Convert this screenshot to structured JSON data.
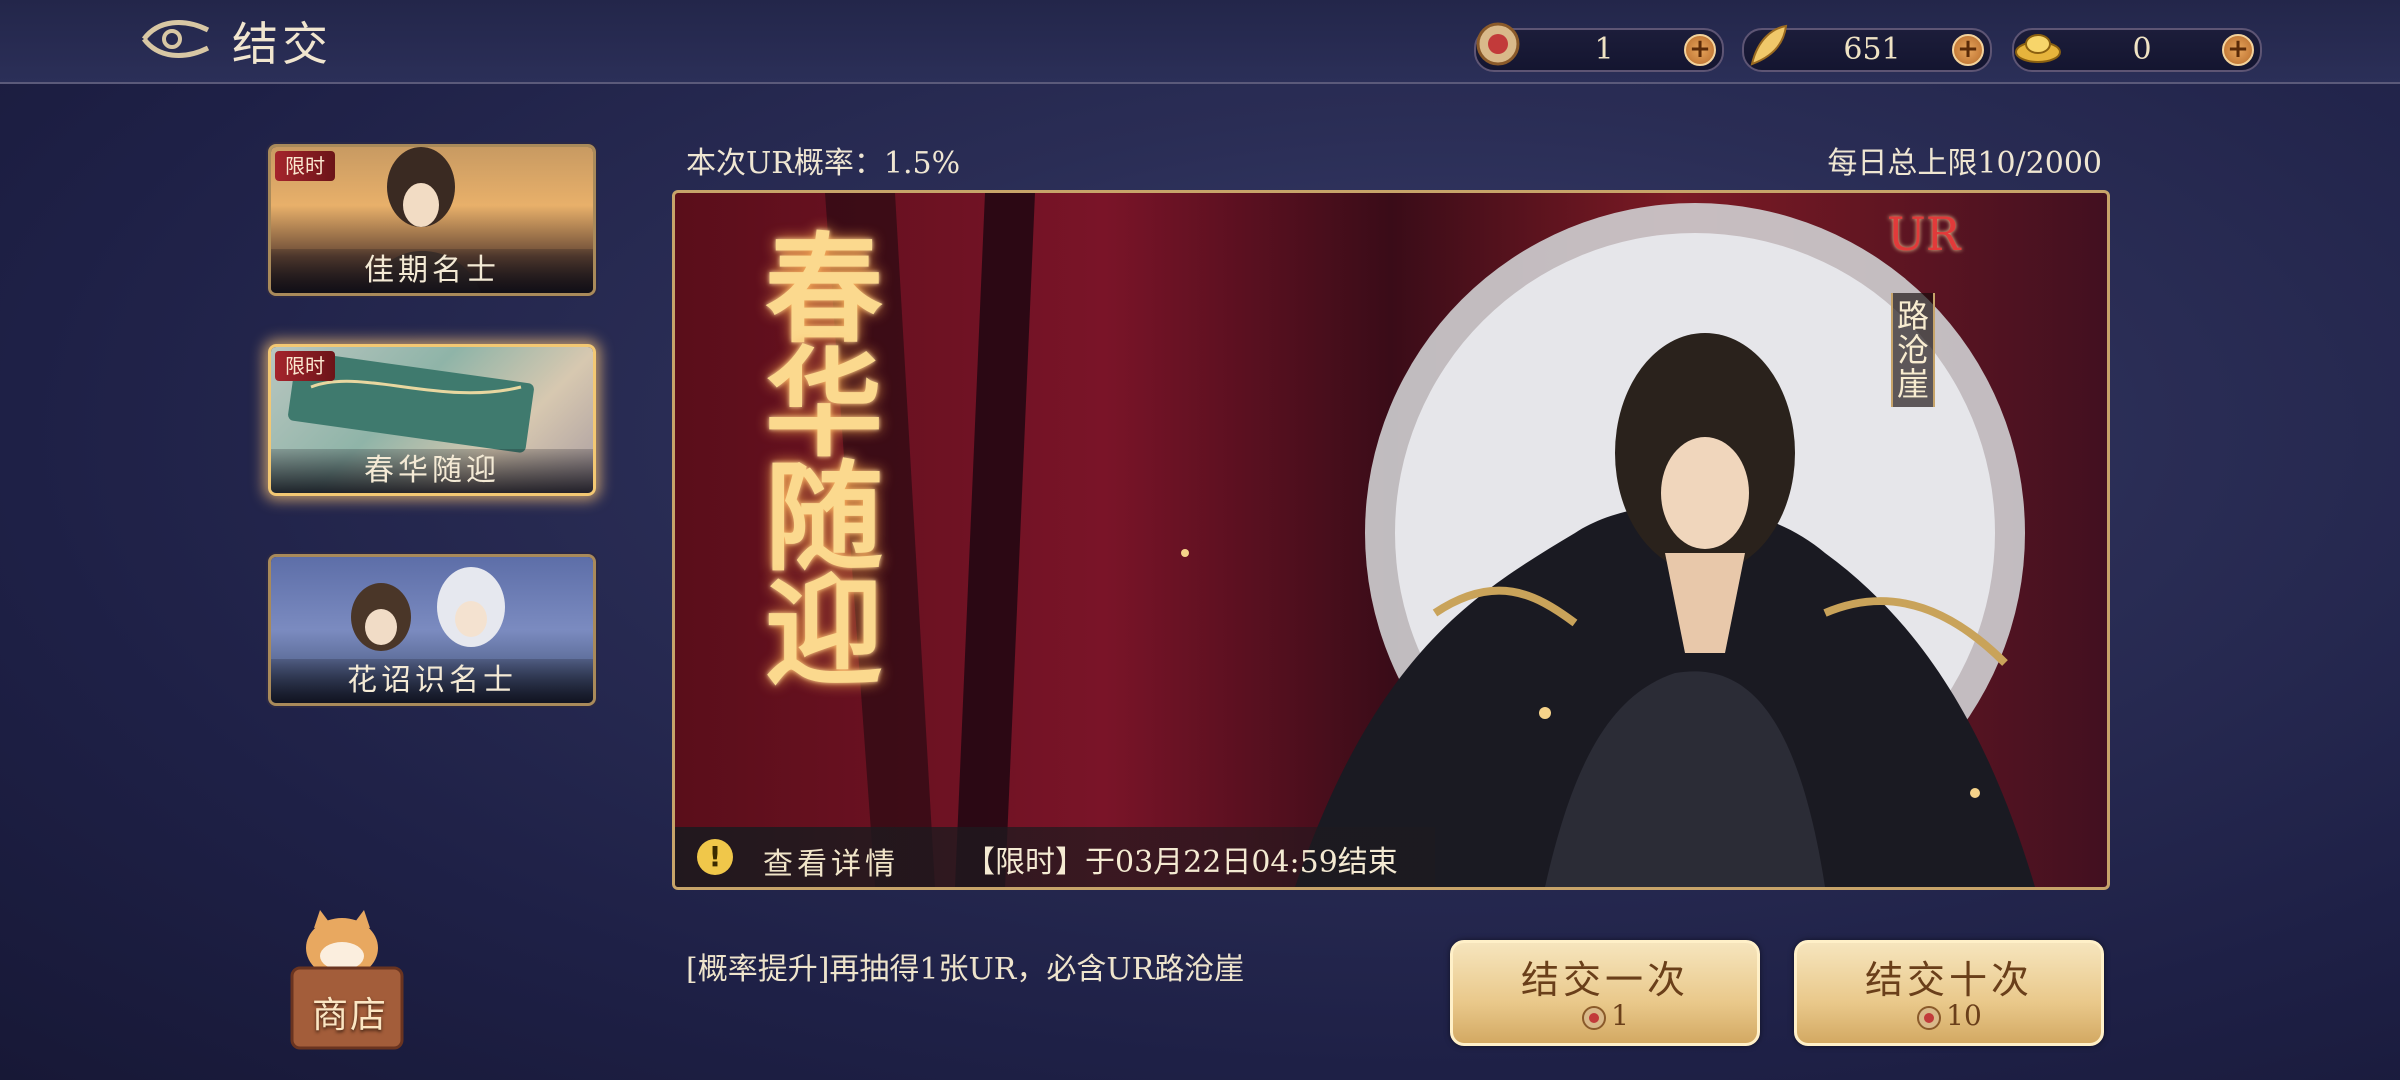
{
  "header": {
    "title": "结交",
    "back_icon": "back-arrow-icon"
  },
  "resources": [
    {
      "icon": "token-coin-icon",
      "value": "1"
    },
    {
      "icon": "feather-icon",
      "value": "651"
    },
    {
      "icon": "gold-ingot-icon",
      "value": "0"
    }
  ],
  "tabs": [
    {
      "label": "佳期名士",
      "badge": "限时",
      "active": false
    },
    {
      "label": "春华随迎",
      "badge": "限时",
      "active": true
    },
    {
      "label": "花诏识名士",
      "badge": "",
      "active": false
    }
  ],
  "banner": {
    "rate_text": "本次UR概率：1.5%",
    "daily_limit": "每日总上限10/2000",
    "title": "春华随迎",
    "rarity": "UR",
    "character_name": "路沧崖",
    "detail_label": "查看详情",
    "end_time": "【限时】于03月22日04:59结束"
  },
  "hint": "[概率提升]再抽得1张UR，必含UR路沧崖",
  "pull_buttons": [
    {
      "label": "结交一次",
      "cost": "1"
    },
    {
      "label": "结交十次",
      "cost": "10"
    }
  ],
  "shop": {
    "label": "商店"
  },
  "colors": {
    "accent_gold": "#c7a46a",
    "badge_red": "#a5242c",
    "button_cream": "#f6e5bd"
  }
}
